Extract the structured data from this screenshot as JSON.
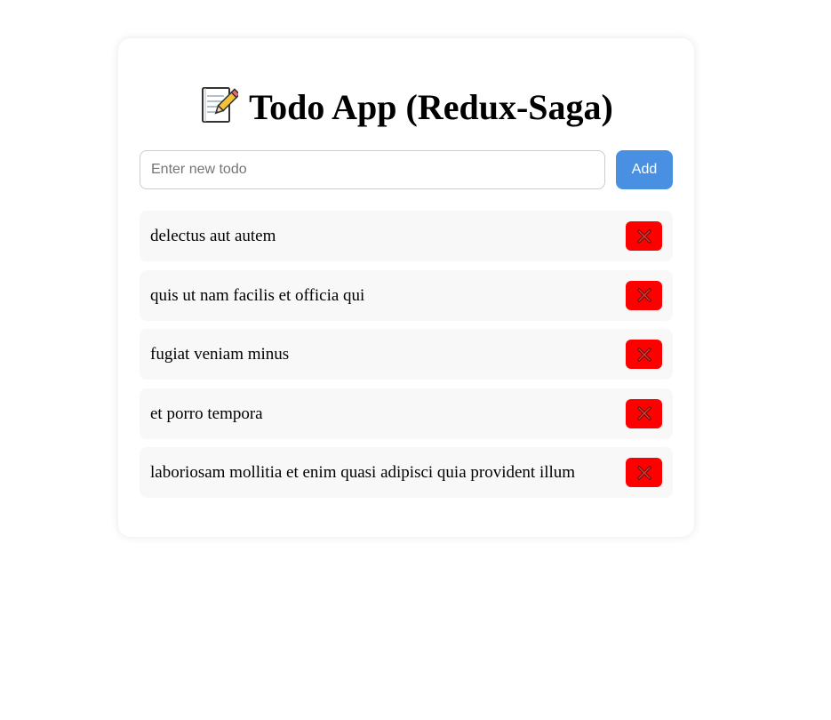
{
  "app": {
    "title": "Todo App (Redux-Saga)",
    "title_icon": "memo-pencil-icon"
  },
  "form": {
    "input_value": "",
    "input_placeholder": "Enter new todo",
    "add_label": "Add"
  },
  "todos": [
    {
      "text": "delectus aut autem"
    },
    {
      "text": "quis ut nam facilis et officia qui"
    },
    {
      "text": "fugiat veniam minus"
    },
    {
      "text": "et porro tempora"
    },
    {
      "text": "laboriosam mollitia et enim quasi adipisci quia provident illum"
    }
  ],
  "colors": {
    "accent": "#4a90e2",
    "delete": "#ff0000",
    "item_background": "#f8f8f8"
  },
  "icons": {
    "delete": "cross-mark-icon"
  }
}
